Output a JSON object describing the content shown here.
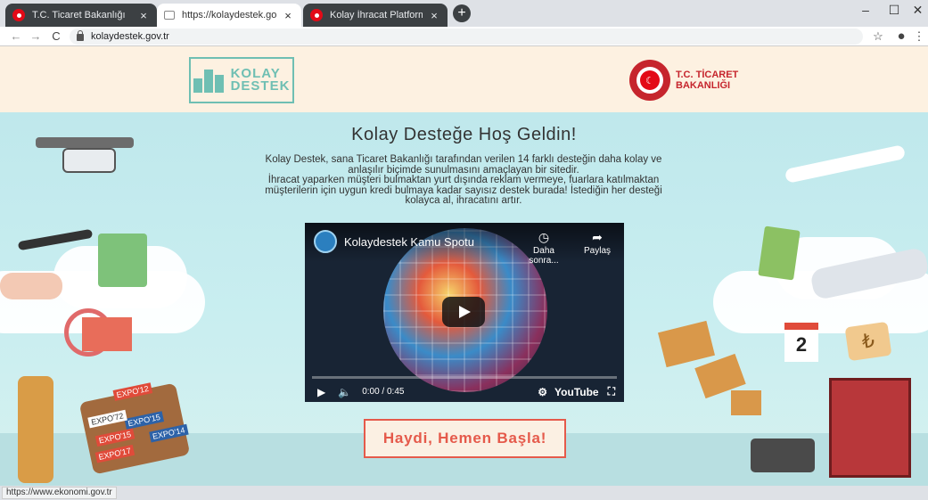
{
  "browser": {
    "tabs": [
      {
        "title": "T.C. Ticaret Bakanlığı",
        "close": "×"
      },
      {
        "title": "https://kolaydestek.gov.tr",
        "close": "×"
      },
      {
        "title": "Kolay İhracat Platformu Anasayfa",
        "close": "×"
      }
    ],
    "new_tab": "+",
    "window_controls": {
      "minimize": "–",
      "maximize": "☐",
      "close": "✕"
    },
    "nav": {
      "back": "←",
      "forward": "→",
      "reload": "C"
    },
    "url": "kolaydestek.gov.tr",
    "toolbar_icons": {
      "bookmark": "☆",
      "profile": "●",
      "menu": "⋮"
    },
    "status_url": "https://www.ekonomi.gov.tr"
  },
  "site": {
    "logo_kolay": [
      "KOLAY",
      "DESTEK"
    ],
    "logo_ministry": [
      "T.C. TİCARET",
      "BAKANLIĞI"
    ],
    "heading": "Kolay Desteğe Hoş Geldin!",
    "intro_lines": [
      "Kolay Destek, sana Ticaret Bakanlığı tarafından verilen 14 farklı desteğin daha kolay ve",
      "anlaşılır biçimde sunulmasını amaçlayan bir sitedir.",
      "İhracat yaparken müşteri bulmaktan yurt dışında reklam vermeye, fuarlara katılmaktan",
      "müşterilerin için uygun kredi bulmaya kadar sayısız destek burada! İstediğin her desteği",
      "kolayca al, ihracatını artır."
    ],
    "cta": "Haydi, Hemen Başla!",
    "deco": {
      "expo_tags": [
        "EXPO'12",
        "EXPO'15",
        "EXPO'14",
        "EXPO'17",
        "EXPO'15",
        "EXPO'72"
      ],
      "calendar_day": "2",
      "lira": "₺"
    }
  },
  "video": {
    "title": "Kolaydestek Kamu Spotu",
    "watch_later": "Daha sonra...",
    "share": "Paylaş",
    "watch_later_icon": "◷",
    "share_icon": "➦",
    "time": "0:00 / 0:45",
    "play_icon": "▶",
    "volume_icon": "🔈",
    "settings_icon": "⚙",
    "brand": "YouTube",
    "fullscreen_icon": "⛶"
  }
}
